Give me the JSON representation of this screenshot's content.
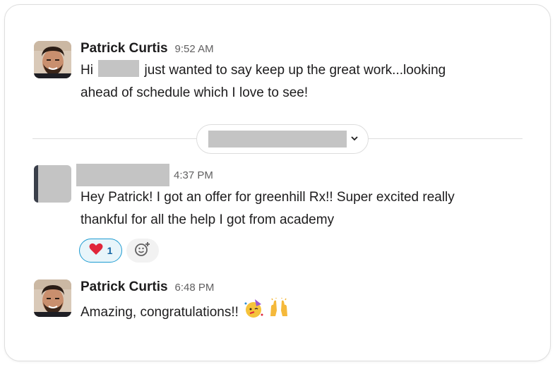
{
  "messages": [
    {
      "sender": "Patrick Curtis",
      "time": "9:52 AM",
      "line1_prefix": "Hi",
      "line1_suffix": "just wanted to say keep up the great work...looking",
      "line2": "ahead of schedule which I love to see!"
    },
    {
      "time": "4:37 PM",
      "line1": "Hey Patrick! I got an offer for greenhill Rx!! Super excited really",
      "line2": "thankful for all the help I got from academy",
      "reactions": [
        {
          "emoji": "heart-emoji",
          "count": "1"
        }
      ]
    },
    {
      "sender": "Patrick Curtis",
      "time": "6:48 PM",
      "line1": "Amazing, congratulations!!",
      "emojis": [
        "partying-face-emoji",
        "raised-hands-emoji"
      ]
    }
  ],
  "date_divider": {
    "icon": "chevron-down-icon"
  },
  "colors": {
    "reaction_border": "#1d9bd1",
    "reaction_bg": "#e8f5fa",
    "reaction_count": "#1264a3",
    "redaction": "#c4c4c4"
  }
}
